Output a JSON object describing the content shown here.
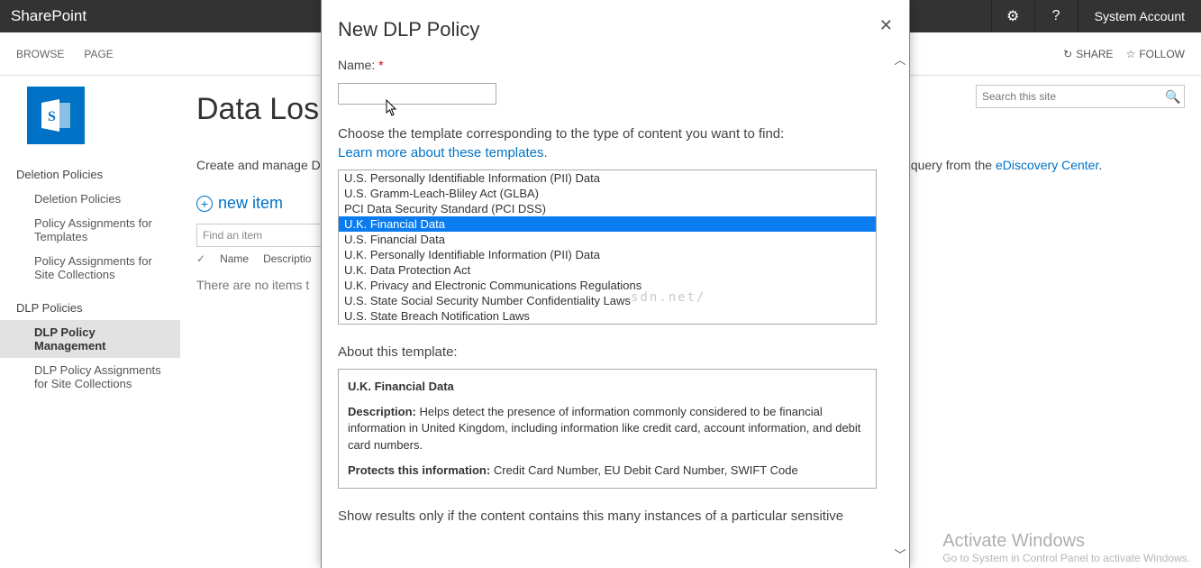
{
  "topbar": {
    "app_title": "SharePoint",
    "account": "System Account"
  },
  "ribbon": {
    "tabs": [
      "BROWSE",
      "PAGE"
    ],
    "share": "SHARE",
    "follow": "FOLLOW"
  },
  "sidebar": {
    "section1": "Deletion Policies",
    "items1": [
      "Deletion Policies",
      "Policy Assignments for Templates",
      "Policy Assignments for Site Collections"
    ],
    "section2": "DLP Policies",
    "items2": [
      "DLP Policy Management",
      "DLP Policy Assignments for Site Collections"
    ]
  },
  "content": {
    "title": "Data Los",
    "desc_prefix": "Create and manage DL",
    "desc_suffix": " query from the ",
    "desc_link": "eDiscovery Center",
    "new_item": "new item",
    "find_placeholder": "Find an item",
    "cols": {
      "name": "Name",
      "desc": "Descriptio"
    },
    "empty": "There are no items t",
    "search_placeholder": "Search this site"
  },
  "modal": {
    "title": "New DLP Policy",
    "name_label": "Name:",
    "choose_text": "Choose the template corresponding to the type of content you want to find:",
    "learn_link": "Learn more about these templates.",
    "templates": [
      "U.S. Personally Identifiable Information (PII) Data",
      "U.S. Gramm-Leach-Bliley Act (GLBA)",
      "PCI Data Security Standard (PCI DSS)",
      "U.K. Financial Data",
      "U.S. Financial Data",
      "U.K. Personally Identifiable Information (PII) Data",
      "U.K. Data Protection Act",
      "U.K. Privacy and Electronic Communications Regulations",
      "U.S. State Social Security Number Confidentiality Laws",
      "U.S. State Breach Notification Laws"
    ],
    "selected_index": 3,
    "about_label": "About this template:",
    "about": {
      "name": "U.K. Financial Data",
      "desc_label": "Description:",
      "desc": "Helps detect the presence of information commonly considered to be financial information in United Kingdom, including information like credit card, account information, and debit card numbers.",
      "protects_label": "Protects this information:",
      "protects": "Credit Card Number, EU Debit Card Number, SWIFT Code"
    },
    "results_text": "Show results only if the content contains this many instances of a particular sensitive"
  },
  "watermark": {
    "title": "Activate Windows",
    "sub": "Go to System in Control Panel to activate Windows.",
    "csdn": "sdn.net/"
  }
}
